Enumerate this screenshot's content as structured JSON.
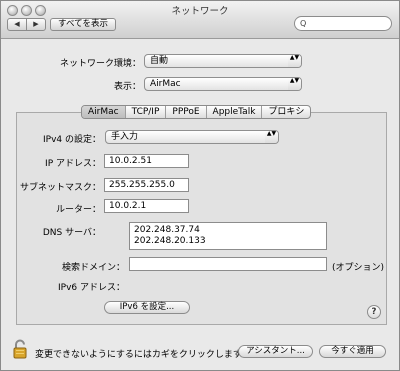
{
  "window": {
    "title": "ネットワーク"
  },
  "toolbar": {
    "back_icon": "left-arrow-icon",
    "forward_icon": "right-arrow-icon",
    "back_glyph": "◀",
    "forward_glyph": "▶",
    "show_all_label": "すべてを表示",
    "search_value": "",
    "search_glyph": "Q"
  },
  "location": {
    "label": "ネットワーク環境：",
    "value": "自動"
  },
  "show": {
    "label": "表示：",
    "value": "AirMac"
  },
  "popup_arrows": "▲▼",
  "tabs": [
    {
      "label": "AirMac",
      "active": true
    },
    {
      "label": "TCP/IP",
      "active": false
    },
    {
      "label": "PPPoE",
      "active": false
    },
    {
      "label": "AppleTalk",
      "active": false
    },
    {
      "label": "プロキシ",
      "active": false
    }
  ],
  "ipv4": {
    "label": "IPv4 の設定：",
    "value": "手入力"
  },
  "ip_address": {
    "label": "IP アドレス：",
    "value": "10.0.2.51"
  },
  "subnet_mask": {
    "label": "サブネットマスク：",
    "value": "255.255.255.0"
  },
  "router": {
    "label": "ルーター：",
    "value": "10.0.2.1"
  },
  "dns": {
    "label": "DNS サーバ：",
    "line1": "202.248.37.74",
    "line2": "202.248.20.133"
  },
  "search_domains": {
    "label": "検索ドメイン：",
    "value": "",
    "hint": "(オプション)"
  },
  "ipv6": {
    "label": "IPv6 アドレス：",
    "button_label": "IPv6 を設定..."
  },
  "help": {
    "label": "?"
  },
  "footer": {
    "lock_text": "変更できないようにするにはカギをクリックします。",
    "assist_label": "アシスタント...",
    "apply_label": "今すぐ適用"
  }
}
